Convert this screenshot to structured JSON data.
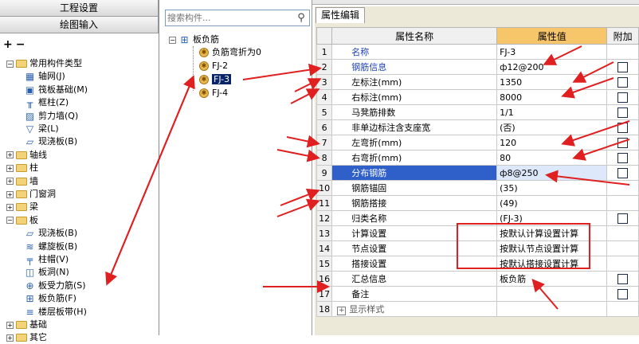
{
  "left_panel": {
    "btn_project_settings": "工程设置",
    "btn_drawing_input": "绘图输入",
    "tree": [
      {
        "label": "常用构件类型",
        "kind": "folder-open"
      },
      {
        "label": "轴网(J)",
        "kind": "grid"
      },
      {
        "label": "筏板基础(M)",
        "kind": "raft"
      },
      {
        "label": "框柱(Z)",
        "kind": "column"
      },
      {
        "label": "剪力墙(Q)",
        "kind": "wall"
      },
      {
        "label": "梁(L)",
        "kind": "beam"
      },
      {
        "label": "现浇板(B)",
        "kind": "slab"
      },
      {
        "label": "轴线",
        "kind": "folder"
      },
      {
        "label": "柱",
        "kind": "folder"
      },
      {
        "label": "墙",
        "kind": "folder"
      },
      {
        "label": "门窗洞",
        "kind": "folder"
      },
      {
        "label": "梁",
        "kind": "folder"
      },
      {
        "label": "板",
        "kind": "folder-open"
      },
      {
        "label": "现浇板(B)",
        "kind": "slab"
      },
      {
        "label": "螺旋板(B)",
        "kind": "spiral"
      },
      {
        "label": "柱帽(V)",
        "kind": "cap"
      },
      {
        "label": "板洞(N)",
        "kind": "hole"
      },
      {
        "label": "板受力筋(S)",
        "kind": "rebar"
      },
      {
        "label": "板负筋(F)",
        "kind": "neg-rebar"
      },
      {
        "label": "楼层板带(H)",
        "kind": "strip"
      },
      {
        "label": "基础",
        "kind": "folder"
      },
      {
        "label": "其它",
        "kind": "folder"
      }
    ]
  },
  "middle_panel": {
    "search_placeholder": "搜索构件...",
    "root_label": "板负筋",
    "items": [
      "负筋弯折为0",
      "FJ-2",
      "FJ-3",
      "FJ-4"
    ],
    "selected": "FJ-3"
  },
  "right_panel": {
    "tab_label": "属性编辑",
    "columns": {
      "name": "属性名称",
      "value": "属性值",
      "add": "附加"
    },
    "rows": [
      {
        "num": "1",
        "name": "名称",
        "value": "FJ-3",
        "checkbox": false,
        "name_color": "blue"
      },
      {
        "num": "2",
        "name": "钢筋信息",
        "value": "ф12@200",
        "checkbox": true,
        "name_color": "blue"
      },
      {
        "num": "3",
        "name": "左标注(mm)",
        "value": "1350",
        "checkbox": true,
        "name_color": "black"
      },
      {
        "num": "4",
        "name": "右标注(mm)",
        "value": "8000",
        "checkbox": true,
        "name_color": "black"
      },
      {
        "num": "5",
        "name": "马凳筋排数",
        "value": "1/1",
        "checkbox": true,
        "name_color": "black"
      },
      {
        "num": "6",
        "name": "非单边标注含支座宽",
        "value": "(否)",
        "checkbox": true,
        "name_color": "black"
      },
      {
        "num": "7",
        "name": "左弯折(mm)",
        "value": "120",
        "checkbox": true,
        "name_color": "black"
      },
      {
        "num": "8",
        "name": "右弯折(mm)",
        "value": "80",
        "checkbox": true,
        "name_color": "black"
      },
      {
        "num": "9",
        "name": "分布钢筋",
        "value": "ф8@250",
        "checkbox": true,
        "name_color": "black",
        "highlight": true
      },
      {
        "num": "10",
        "name": "钢筋锚固",
        "value": "(35)",
        "checkbox": false,
        "name_color": "black"
      },
      {
        "num": "11",
        "name": "钢筋搭接",
        "value": "(49)",
        "checkbox": false,
        "name_color": "black"
      },
      {
        "num": "12",
        "name": "归类名称",
        "value": "(FJ-3)",
        "checkbox": true,
        "name_color": "black"
      },
      {
        "num": "13",
        "name": "计算设置",
        "value": "按默认计算设置计算",
        "checkbox": false,
        "name_color": "black"
      },
      {
        "num": "14",
        "name": "节点设置",
        "value": "按默认节点设置计算",
        "checkbox": false,
        "name_color": "black"
      },
      {
        "num": "15",
        "name": "搭接设置",
        "value": "按默认搭接设置计算",
        "checkbox": false,
        "name_color": "black"
      },
      {
        "num": "16",
        "name": "汇总信息",
        "value": "板负筋",
        "checkbox": true,
        "name_color": "black"
      },
      {
        "num": "17",
        "name": "备注",
        "value": "",
        "checkbox": true,
        "name_color": "black"
      },
      {
        "num": "18",
        "name": "显示样式",
        "value": "",
        "checkbox": false,
        "name_color": "gray",
        "expandable": true
      }
    ]
  },
  "colors": {
    "accent_header": "#f7c66a",
    "highlight_row": "#2f5fc9",
    "annotation": "#e02020",
    "selection": "#0a246a"
  }
}
